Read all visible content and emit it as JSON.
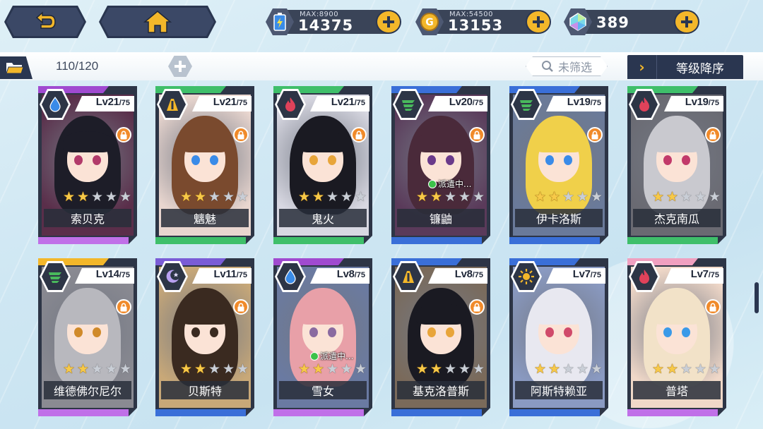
{
  "header": {
    "back_icon": "back-arrow-icon",
    "home_icon": "home-icon"
  },
  "resources": {
    "energy": {
      "icon": "energy-battery-icon",
      "max_label": "MAX:8900",
      "value": "14375",
      "color": "#3a8be8"
    },
    "gold": {
      "icon": "gold-coin-icon",
      "max_label": "MAX:54500",
      "value": "13153",
      "color": "#f3b72a"
    },
    "gem": {
      "icon": "crystal-gem-icon",
      "value": "389",
      "color": "#5fd4c3"
    }
  },
  "toolbar": {
    "count": "110/120",
    "filter_label": "未筛选",
    "sort_label": "等级降序"
  },
  "colors": {
    "accent": "#f3b72a",
    "dark": "#2a3650",
    "water": "#3a6fd8",
    "earth": "#f3b72a",
    "fire": "#e0425a",
    "wind": "#49b85c",
    "dark_element": "#7a5cd6",
    "light_element": "#f3b72a"
  },
  "characters": [
    {
      "name": "索贝克",
      "level": "Lv21",
      "max": "/75",
      "element": "water",
      "stars": 2,
      "locked": true,
      "dispatch": "",
      "top_color": "#a04ad0",
      "bottom_color": "#c070e8",
      "hair": "#1d1d28",
      "eye": "#b23a6a",
      "bg": "#5a2e4a"
    },
    {
      "name": "魑魅",
      "level": "Lv21",
      "max": "/75",
      "element": "earth",
      "stars": 2,
      "locked": true,
      "dispatch": "",
      "top_color": "#3fbf6a",
      "bottom_color": "#3fbf6a",
      "hair": "#7a4a2e",
      "eye": "#3a8be8",
      "bg": "#e9d6cf"
    },
    {
      "name": "鬼火",
      "level": "Lv21",
      "max": "/75",
      "element": "fire",
      "stars": 2,
      "locked": true,
      "dispatch": "",
      "top_color": "#3fbf6a",
      "bottom_color": "#3fbf6a",
      "hair": "#1a1a22",
      "eye": "#e8a53a",
      "bg": "#d8d8e2"
    },
    {
      "name": "镰鼬",
      "level": "Lv20",
      "max": "/75",
      "element": "wind",
      "stars": 2,
      "locked": true,
      "dispatch": "派遣中...",
      "top_color": "#3a6fd8",
      "bottom_color": "#3a6fd8",
      "hair": "#4a2a3a",
      "eye": "#6a3a8a",
      "bg": "#5a3a5a"
    },
    {
      "name": "伊卡洛斯",
      "level": "Lv19",
      "max": "/75",
      "element": "wind",
      "stars": 2,
      "locked": true,
      "dispatch": "",
      "top_color": "#3a6fd8",
      "bottom_color": "#3a6fd8",
      "hair": "#f0d04a",
      "eye": "#3a8be8",
      "bg": "#6a7a9a"
    },
    {
      "name": "杰克南瓜",
      "level": "Lv19",
      "max": "/75",
      "element": "fire",
      "stars": 2,
      "locked": true,
      "dispatch": "",
      "top_color": "#3fbf6a",
      "bottom_color": "#3fbf6a",
      "hair": "#c9c9cf",
      "eye": "#c23a6a",
      "bg": "#6a6a72"
    },
    {
      "name": "维德佛尔尼尔",
      "level": "Lv14",
      "max": "/75",
      "element": "wind",
      "stars": 2,
      "locked": true,
      "dispatch": "",
      "top_color": "#f3b72a",
      "bottom_color": "#c070e8",
      "hair": "#b8b8be",
      "eye": "#d08a2a",
      "bg": "#8a8a92"
    },
    {
      "name": "贝斯特",
      "level": "Lv11",
      "max": "/75",
      "element": "dark_element",
      "stars": 2,
      "locked": true,
      "dispatch": "",
      "top_color": "#7a5cd6",
      "bottom_color": "#3a6fd8",
      "hair": "#3a2a20",
      "eye": "#3a2a20",
      "bg": "#c8a878"
    },
    {
      "name": "雪女",
      "level": "Lv8",
      "max": "/75",
      "element": "water",
      "stars": 2,
      "locked": false,
      "dispatch": "派遣中...",
      "top_color": "#a04ad0",
      "bottom_color": "#c070e8",
      "hair": "#e8a0a8",
      "eye": "#8a6aa0",
      "bg": "#6a7aa2"
    },
    {
      "name": "基克洛普斯",
      "level": "Lv8",
      "max": "/75",
      "element": "earth",
      "stars": 2,
      "locked": true,
      "dispatch": "",
      "top_color": "#3a6fd8",
      "bottom_color": "#3a6fd8",
      "hair": "#1a1a22",
      "eye": "#e8a53a",
      "bg": "#7a6a5a"
    },
    {
      "name": "阿斯特赖亚",
      "level": "Lv7",
      "max": "/75",
      "element": "light_element",
      "stars": 2,
      "locked": false,
      "dispatch": "",
      "top_color": "#3a6fd8",
      "bottom_color": "#3a6fd8",
      "hair": "#e8e8f0",
      "eye": "#d04a6a",
      "bg": "#8a9ac2"
    },
    {
      "name": "普塔",
      "level": "Lv7",
      "max": "/75",
      "element": "fire",
      "stars": 2,
      "locked": true,
      "dispatch": "",
      "top_color": "#f0a0c0",
      "bottom_color": "#c070e8",
      "hair": "#f2e2c8",
      "eye": "#3a9ae8",
      "bg": "#f0d8c8"
    }
  ]
}
